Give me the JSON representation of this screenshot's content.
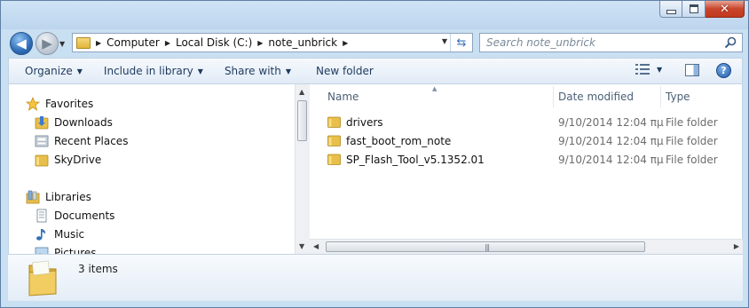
{
  "window": {
    "title_ghost": "note_unbrick",
    "controls": {
      "minimize": "minimize",
      "maximize": "maximize",
      "close": "✕"
    }
  },
  "navigation": {
    "back_label": "◀",
    "forward_label": "▶",
    "address": {
      "crumbs": [
        "Computer",
        "Local Disk (C:)",
        "note_unbrick"
      ]
    },
    "search": {
      "placeholder": "Search note_unbrick"
    }
  },
  "commandbar": {
    "organize": "Organize",
    "include_in_library": "Include in library",
    "share_with": "Share with",
    "new_folder": "New folder"
  },
  "navpane": {
    "favorites_header": "Favorites",
    "favorites": [
      "Downloads",
      "Recent Places",
      "SkyDrive"
    ],
    "libraries_header": "Libraries",
    "libraries": [
      "Documents",
      "Music",
      "Pictures"
    ]
  },
  "filelist": {
    "columns": {
      "name": "Name",
      "date": "Date modified",
      "type": "Type"
    },
    "rows": [
      {
        "name": "drivers",
        "date": "9/10/2014 12:04 πμ",
        "type": "File folder"
      },
      {
        "name": "fast_boot_rom_note",
        "date": "9/10/2014 12:04 πμ",
        "type": "File folder"
      },
      {
        "name": "SP_Flash_Tool_v5.1352.01",
        "date": "9/10/2014 12:04 πμ",
        "type": "File folder"
      }
    ]
  },
  "details": {
    "item_count": "3 items"
  },
  "colors": {
    "folder_yellow": "#e8bf4a",
    "accent_blue": "#2f6db8",
    "close_red": "#c8452c"
  }
}
